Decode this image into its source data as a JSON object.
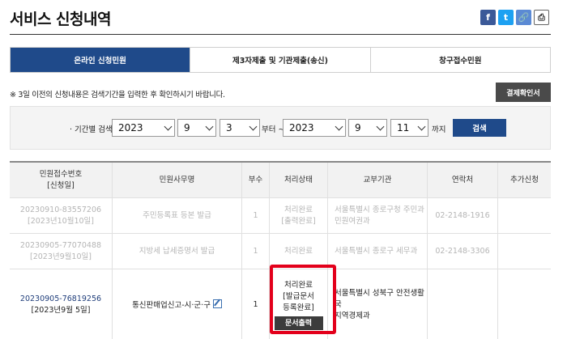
{
  "page": {
    "title": "서비스 신청내역"
  },
  "share": {
    "facebook": "f",
    "twitter": "t",
    "link": "🔗",
    "print": "⎙"
  },
  "tabs": [
    {
      "label": "온라인 신청민원",
      "active": true
    },
    {
      "label": "제3자제출 및 기관제출(송신)",
      "active": false
    },
    {
      "label": "창구접수민원",
      "active": false
    }
  ],
  "notice": "※ 3일 이전의 신청내용은 검색기간을 입력한 후 확인하시기 바랍니다.",
  "payment_button": "결제확인서",
  "search": {
    "label": "· 기간별 검색",
    "from_year": "2023",
    "from_month": "9",
    "from_day": "3",
    "from_suffix": "부터 ~",
    "to_year": "2023",
    "to_month": "9",
    "to_day": "11",
    "to_suffix": "까지",
    "button": "검색"
  },
  "table": {
    "headers": {
      "receipt_no": "민원접수번호",
      "receipt_date": "[신청일]",
      "service_name": "민원사무명",
      "copies": "부수",
      "status": "처리상태",
      "agency": "교부기관",
      "contact": "연락처",
      "extra": "추가신청"
    },
    "rows": [
      {
        "receipt_no": "20230910-83557206",
        "receipt_date": "[2023년10월10일]",
        "service_name": "주민등록표 등본 발급",
        "copies": "1",
        "status_line1": "처리완료",
        "status_line2": "[출력완료]",
        "agency_line1": "서울특별시 종로구청 주민과",
        "agency_line2": "민원여권과",
        "contact": "02-2148-1916"
      },
      {
        "receipt_no": "20230905-77070488",
        "receipt_date": "[2023년9월10일]",
        "service_name": "지방세 납세증명서 발급",
        "copies": "1",
        "status_line1": "처리완료",
        "status_line2": "",
        "agency_line1": "서울특별시 종로구 세무과",
        "agency_line2": "",
        "contact": "02-2148-3306"
      },
      {
        "receipt_no": "20230905-76819256",
        "receipt_date": "[2023년9월 5일]",
        "service_name": "통신판매업신고-시·군·구",
        "copies": "1",
        "status_line1": "처리완료",
        "status_line2": "[발급문서",
        "status_line3": "등록완료]",
        "status_button": "문서출력",
        "agency_line1": "서울특별시 성북구 안전생활국",
        "agency_line2": "지역경제과",
        "contact": ""
      }
    ]
  },
  "colors": {
    "primary": "#1f4a8a",
    "highlight": "#e3001b",
    "dark_button": "#4a4a4a"
  }
}
